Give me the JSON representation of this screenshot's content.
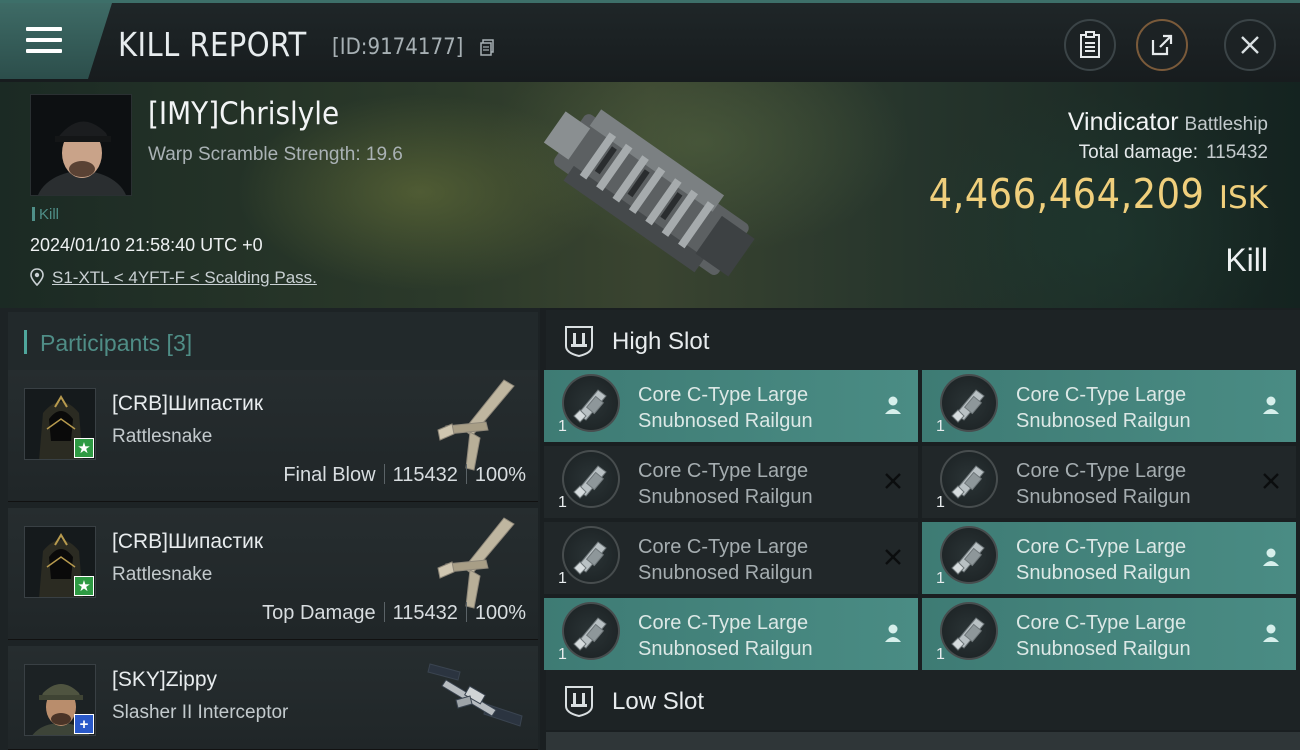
{
  "header": {
    "title": "KILL REPORT",
    "report_id": "[ID:9174177]"
  },
  "victim": {
    "name": "[IMY]Chrislyle",
    "warp_scramble": "Warp Scramble Strength: 19.6",
    "tag": "Kill",
    "time": "2024/01/10 21:58:40 UTC +0",
    "location": "S1-XTL < 4YFT-F < Scalding Pass.",
    "ship_name": "Vindicator",
    "ship_class": "Battleship",
    "total_damage_label": "Total damage:",
    "total_damage": "115432",
    "isk_value": "4,466,464,209",
    "isk_unit": "ISK",
    "result": "Kill"
  },
  "participants": {
    "title": "Participants [3]",
    "items": [
      {
        "name": "[CRB]Шипастик",
        "ship": "Rattlesnake",
        "role": "Final Blow",
        "damage": "115432",
        "percent": "100%",
        "badge": "★",
        "badge_color": "#2e9a43"
      },
      {
        "name": "[CRB]Шипастик",
        "ship": "Rattlesnake",
        "role": "Top Damage",
        "damage": "115432",
        "percent": "100%",
        "badge": "★",
        "badge_color": "#2e9a43"
      },
      {
        "name": "[SKY]Zippy",
        "ship": "Slasher II Interceptor",
        "badge": "+",
        "badge_color": "#2a59c9"
      }
    ]
  },
  "slots": {
    "high_title": "High Slot",
    "low_title": "Low Slot",
    "high_modules": [
      {
        "line1": "Core C-Type Large",
        "line2": "Snubnosed Railgun",
        "qty": "1",
        "status": "fitted"
      },
      {
        "line1": "Core C-Type Large",
        "line2": "Snubnosed Railgun",
        "qty": "1",
        "status": "fitted"
      },
      {
        "line1": "Core C-Type Large",
        "line2": "Snubnosed Railgun",
        "qty": "1",
        "status": "destroyed"
      },
      {
        "line1": "Core C-Type Large",
        "line2": "Snubnosed Railgun",
        "qty": "1",
        "status": "destroyed"
      },
      {
        "line1": "Core C-Type Large",
        "line2": "Snubnosed Railgun",
        "qty": "1",
        "status": "destroyed"
      },
      {
        "line1": "Core C-Type Large",
        "line2": "Snubnosed Railgun",
        "qty": "1",
        "status": "fitted"
      },
      {
        "line1": "Core C-Type Large",
        "line2": "Snubnosed Railgun",
        "qty": "1",
        "status": "fitted"
      },
      {
        "line1": "Core C-Type Large",
        "line2": "Snubnosed Railgun",
        "qty": "1",
        "status": "fitted"
      }
    ]
  },
  "colors": {
    "accent": "#4fa69c",
    "isk": "#f0cf7c",
    "fitted_bg": "#4a8c84"
  },
  "icons": {
    "menu": "menu-icon",
    "copy": "copy-icon",
    "clipboard": "clipboard-icon",
    "share": "share-icon",
    "close": "close-icon",
    "location": "location-pin-icon",
    "slot": "slot-icon",
    "fitted": "user-icon",
    "destroyed": "x-icon"
  }
}
